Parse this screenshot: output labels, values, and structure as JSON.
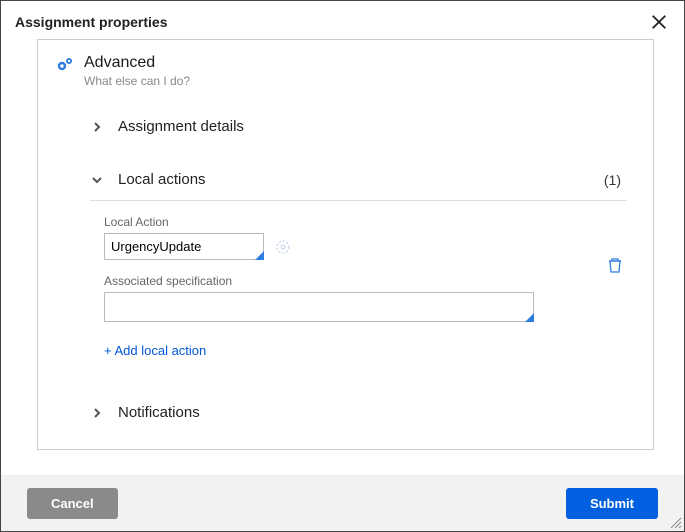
{
  "dialog": {
    "title": "Assignment properties"
  },
  "panel": {
    "title": "Advanced",
    "subtitle": "What else can I do?"
  },
  "sections": {
    "details": {
      "label": "Assignment details"
    },
    "local_actions": {
      "label": "Local actions",
      "count": "(1)",
      "field_label": "Local Action",
      "field_value": "UrgencyUpdate",
      "assoc_label": "Associated specification",
      "assoc_value": "",
      "add_link": "+ Add local action"
    },
    "notifications": {
      "label": "Notifications"
    }
  },
  "footer": {
    "cancel": "Cancel",
    "submit": "Submit"
  }
}
